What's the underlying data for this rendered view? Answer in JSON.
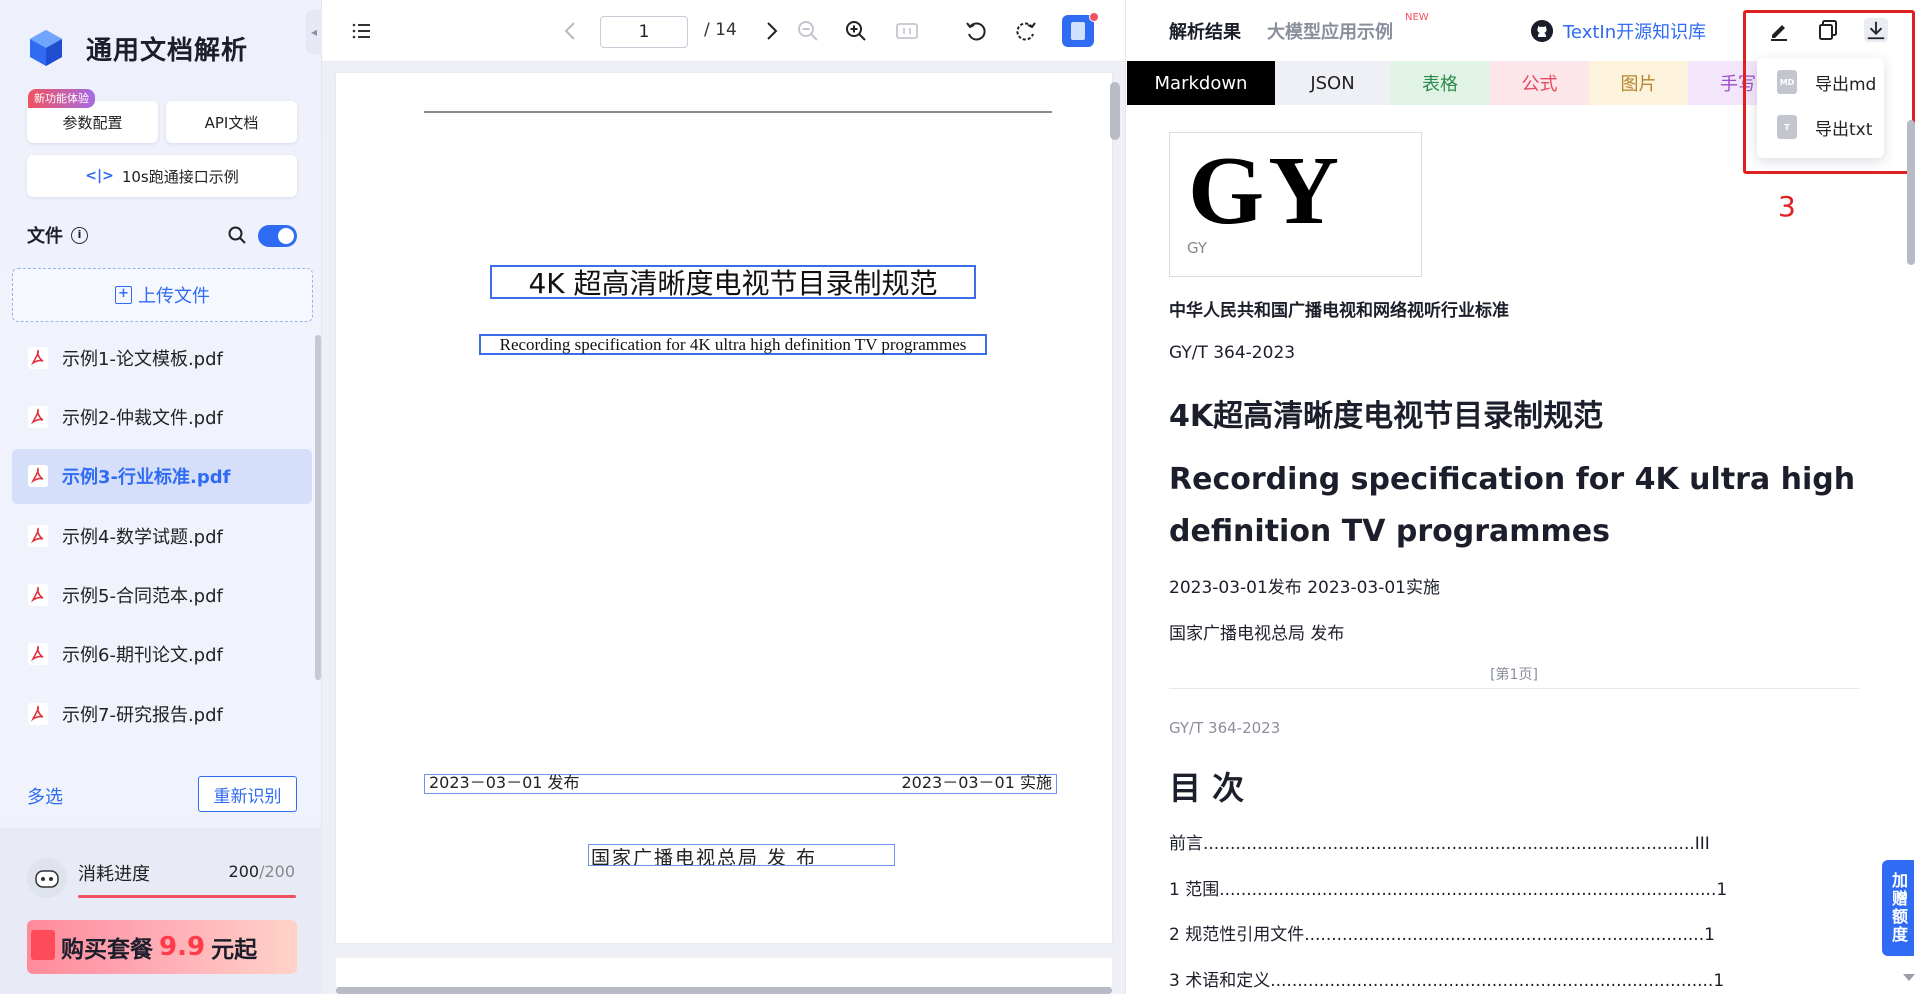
{
  "app": {
    "title": "通用文档解析"
  },
  "sidebar": {
    "new_badge": "新功能体验",
    "params_label": "参数配置",
    "api_label": "API文档",
    "demo_label": "10s跑通接口示例",
    "files_title": "文件",
    "upload_label": "上传文件",
    "files": [
      "示例1-论文模板.pdf",
      "示例2-仲裁文件.pdf",
      "示例3-行业标准.pdf",
      "示例4-数学试题.pdf",
      "示例5-合同范本.pdf",
      "示例6-期刊论文.pdf",
      "示例7-研究报告.pdf"
    ],
    "active_index": 2,
    "multi_select": "多选",
    "rescan": "重新识别",
    "usage": {
      "label": "消耗进度",
      "used": "200",
      "total": "/200",
      "fraction": 1.0
    },
    "buy": {
      "prefix": "购买套餐",
      "price": "9.9",
      "suffix": "元起"
    }
  },
  "viewer": {
    "current_page": "1",
    "total_pages": "/ 14",
    "page": {
      "title": "4K 超高清晰度电视节目录制规范",
      "subtitle": "Recording specification for 4K ultra high definition TV programmes",
      "publish_date": "2023－03－01 发布",
      "impl_date": "2023－03－01 实施",
      "org": "国家广播电视总局  发 布"
    }
  },
  "results": {
    "tab_result": "解析结果",
    "tab_llm": "大模型应用示例",
    "new_label": "NEW",
    "github_label": "TextIn开源知识库",
    "formats": [
      "Markdown",
      "JSON",
      "表格",
      "公式",
      "图片",
      "手写"
    ],
    "export": {
      "md": "导出md",
      "txt": "导出txt",
      "md_icon": "MD",
      "txt_icon": "T"
    },
    "annotation": "3",
    "markdown": {
      "logo_text": "GY",
      "logo_caption": "GY",
      "std_line": "中华人民共和国广播电视和网络视听行业标准",
      "code": "GY/T 364-2023",
      "h1": "4K超高清晰度电视节目录制规范",
      "h1_en": "Recording specification for 4K ultra high definition TV programmes",
      "dates": "2023-03-01发布 2023-03-01实施",
      "org": "国家广播电视总局 发布",
      "page_marker": "[第1页]",
      "code2": "GY/T 364-2023",
      "toc_title": "目 次",
      "toc": [
        "前言...........................................................................................III",
        "1 范围............................................................................................1",
        "2 规范性引用文件..........................................................................1",
        "3 术语和定义..................................................................................1"
      ]
    },
    "quota_tab": "加赠额度"
  },
  "colors": {
    "accent": "#2f6bf3",
    "danger": "#e02020",
    "pdf_red": "#e0333f"
  }
}
